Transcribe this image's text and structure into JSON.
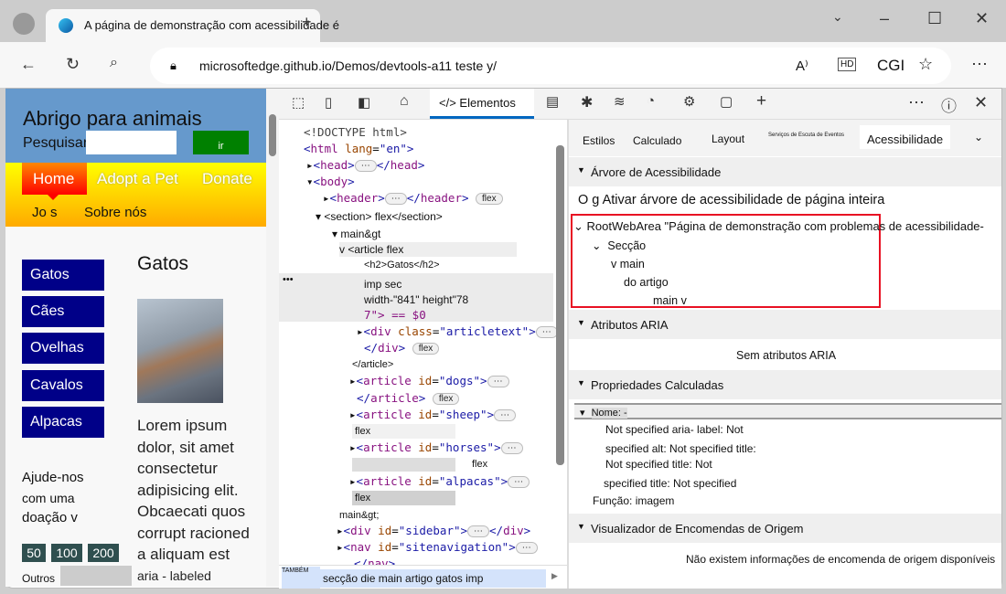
{
  "browser": {
    "tab_title": "A página de demonstração com acessibilidade é",
    "url": "microsoftedge.github.io/Demos/devtools-a11 teste y/",
    "cgi": "CGI"
  },
  "page": {
    "title": "Abrigo para animais",
    "search_label": "Pesquisar",
    "go": "ir",
    "nav": [
      "Home",
      "Adopt a Pet",
      "Donate"
    ],
    "subnav": [
      "Jo s",
      "Sobre nós"
    ],
    "sidebar": [
      "Gatos",
      "Cães",
      "Ovelhas",
      "Cavalos",
      "Alpacas"
    ],
    "heading": "Gatos",
    "lorem": [
      "Lorem ipsum",
      "dolor, sit amet",
      "consectetur",
      "adipisicing elit.",
      "Obcaecati quos",
      "corrupt racioned",
      "a aliquam est",
      "aria - labeled"
    ],
    "donate": [
      "Ajude-nos",
      "com uma",
      "doação v"
    ],
    "amounts": [
      "50",
      "100",
      "200"
    ],
    "other": "Outros"
  },
  "devtools": {
    "elements_tab": "Elementos",
    "dom": {
      "doctype": "<!DOCTYPE html>",
      "section": "<section> flex</section>",
      "main": "main&gt",
      "article": "v <article flex",
      "h2": "<h2>Gatos</h2>",
      "img1": "imp sec",
      "img2": "width-\"841\" height\"78",
      "img3": "7\"> == $0",
      "close_article": "</article>",
      "main_close": "main&gt;",
      "flex": "flex",
      "breadcrumb_label": "TAMBÉM",
      "breadcrumb": "secção die main artigo gatos imp"
    },
    "subtabs": [
      "Estilos",
      "Calculado",
      "Layout",
      "Serviços de Escuta de Eventos",
      "Acessibilidade"
    ],
    "a11y": {
      "tree_header": "Árvore de Acessibilidade",
      "enable_full": "O g Ativar árvore de acessibilidade de página inteira",
      "root": "RootWebArea \"Página de demonstração com problemas de acessibilidade-",
      "seccao": "Secção",
      "main": "v main",
      "artigo": "do artigo",
      "mainv": "main v",
      "aria_header": "Atributos ARIA",
      "no_aria": "Sem atributos ARIA",
      "computed_header": "Propriedades Calculadas",
      "name": "Nome: -",
      "props": [
        "Not specified aria- label: Not",
        "specified alt: Not specified title:",
        "Not specified title: Not",
        "specified title: Not specified"
      ],
      "role": "Função: imagem",
      "source_header": "Visualizador de Encomendas de Origem",
      "no_source": "Não existem informações de encomenda de origem disponíveis"
    }
  },
  "colors": {
    "highlight": "#e81123",
    "accent": "#0067c0"
  }
}
